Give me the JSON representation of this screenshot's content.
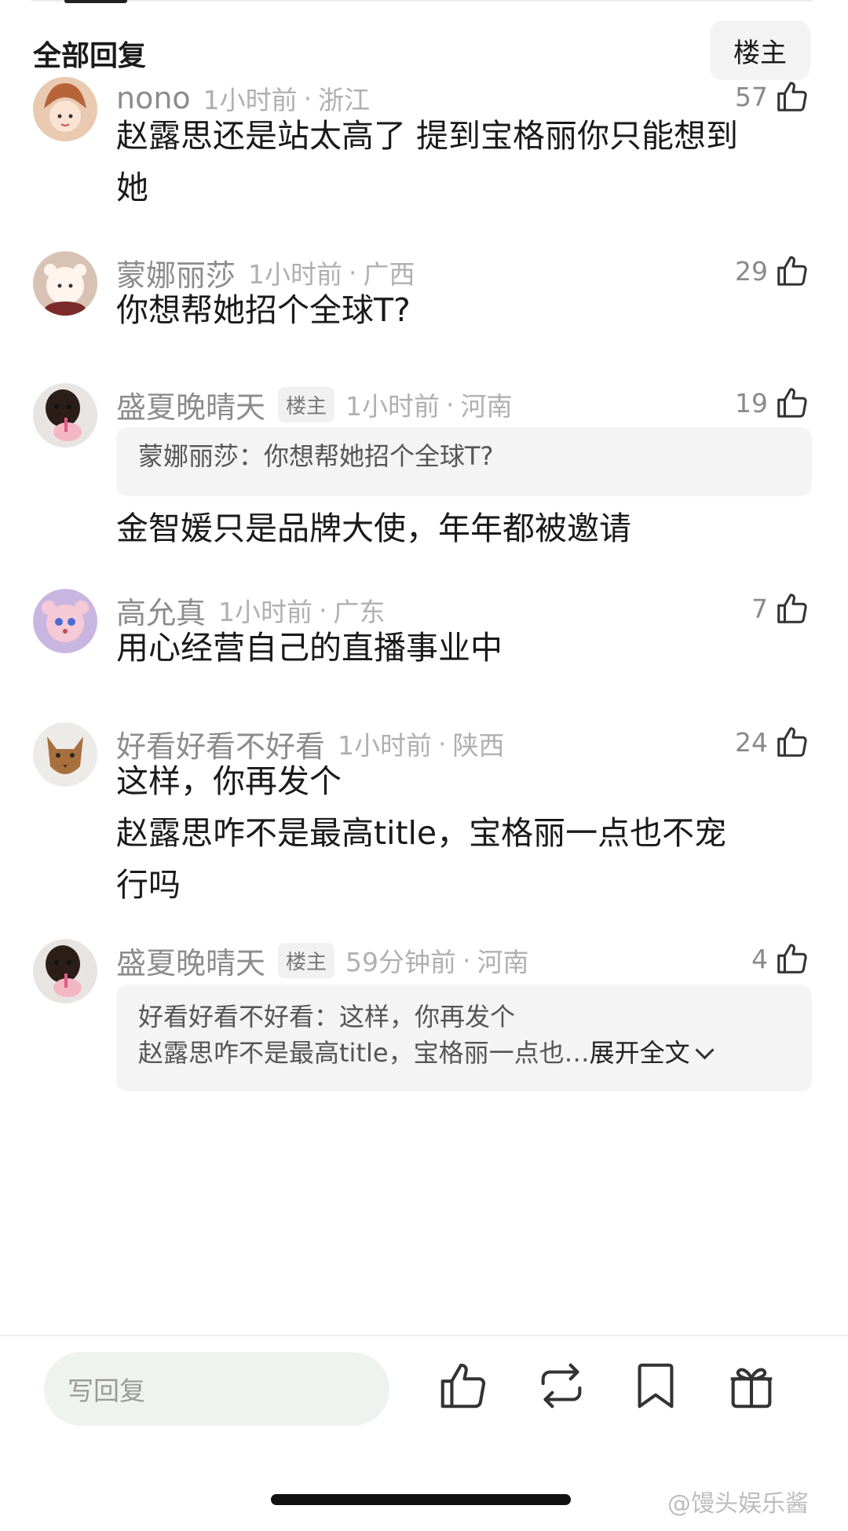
{
  "header": {
    "title": "全部回复",
    "op_filter": "楼主"
  },
  "comments": [
    {
      "username": "nono",
      "op_badge": "",
      "time": "1小时前",
      "location": "浙江",
      "likes": "57",
      "lines": [
        "赵露思还是站太高了 提到宝格丽你只能想到",
        "她"
      ]
    },
    {
      "username": "蒙娜丽莎",
      "op_badge": "",
      "time": "1小时前",
      "location": "广西",
      "likes": "29",
      "lines": [
        "你想帮她招个全球T?"
      ]
    },
    {
      "username": "盛夏晚晴天",
      "op_badge": "楼主",
      "time": "1小时前",
      "location": "河南",
      "likes": "19",
      "quote": [
        "蒙娜丽莎：你想帮她招个全球T?"
      ],
      "lines": [
        "金智媛只是品牌大使，年年都被邀请"
      ]
    },
    {
      "username": "高允真",
      "op_badge": "",
      "time": "1小时前",
      "location": "广东",
      "likes": "7",
      "lines": [
        "用心经营自己的直播事业中"
      ]
    },
    {
      "username": "好看好看不好看",
      "op_badge": "",
      "time": "1小时前",
      "location": "陕西",
      "likes": "24",
      "lines": [
        "这样，你再发个",
        "赵露思咋不是最高title，宝格丽一点也不宠",
        "行吗"
      ]
    },
    {
      "username": "盛夏晚晴天",
      "op_badge": "楼主",
      "time": "59分钟前",
      "location": "河南",
      "likes": "4",
      "quote": [
        "好看好看不好看：这样，你再发个",
        "赵露思咋不是最高title，宝格丽一点也…"
      ],
      "quote_expand": "展开全文"
    }
  ],
  "bottom_bar": {
    "reply_placeholder": "写回复",
    "icons": [
      "like-icon",
      "repost-icon",
      "bookmark-icon",
      "gift-icon"
    ]
  },
  "watermark": "@馒头娱乐酱",
  "colors": {
    "text": "#1a1a1a",
    "meta": "#8c8c8c",
    "muted": "#b0b0b0",
    "quote_bg": "#f4f4f4",
    "input_bg": "#eff3ef"
  }
}
